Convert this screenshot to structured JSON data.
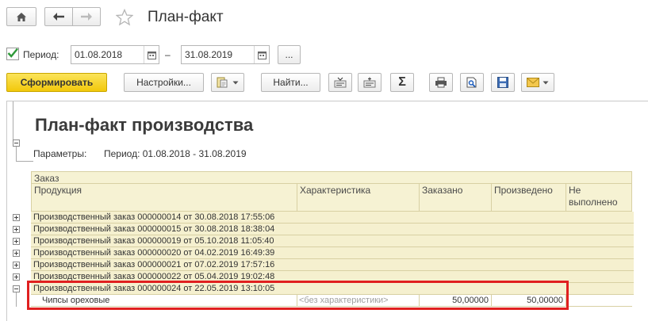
{
  "window": {
    "title": "План-факт"
  },
  "filter": {
    "period_label": "Период:",
    "period_checked": true,
    "date_from": "01.08.2018",
    "dash": "–",
    "date_to": "31.08.2019",
    "select_label": "..."
  },
  "toolbar": {
    "generate": "Сформировать",
    "settings": "Настройки...",
    "find": "Найти..."
  },
  "report": {
    "title": "План-факт производства",
    "params_label": "Параметры:",
    "params_value": "Период: 01.08.2018 - 31.08.2019",
    "headers": {
      "group": "Заказ",
      "product": "Продукция",
      "characteristic": "Характеристика",
      "ordered": "Заказано",
      "produced": "Произведено",
      "not_done_1": "Не",
      "not_done_2": "выполнено"
    },
    "orders": [
      "Производственный заказ 000000014 от 30.08.2018 17:55:06",
      "Производственный заказ 000000015 от 30.08.2018 18:38:04",
      "Производственный заказ 000000019 от 05.10.2018 11:05:40",
      "Производственный заказ 000000020 от 04.02.2019 16:49:39",
      "Производственный заказ 000000021 от 07.02.2019 17:57:16",
      "Производственный заказ 000000022 от 05.04.2019 19:02:48",
      "Производственный заказ 000000024 от 22.05.2019 13:10:05"
    ],
    "detail": {
      "product": "Чипсы ореховые",
      "characteristic": "<без характеристики>",
      "ordered": "50,00000",
      "produced": "50,00000",
      "not_done": ""
    }
  },
  "colors": {
    "accent": "#f7d117",
    "header_bg": "#f6f2d3",
    "highlight": "#e02020"
  }
}
